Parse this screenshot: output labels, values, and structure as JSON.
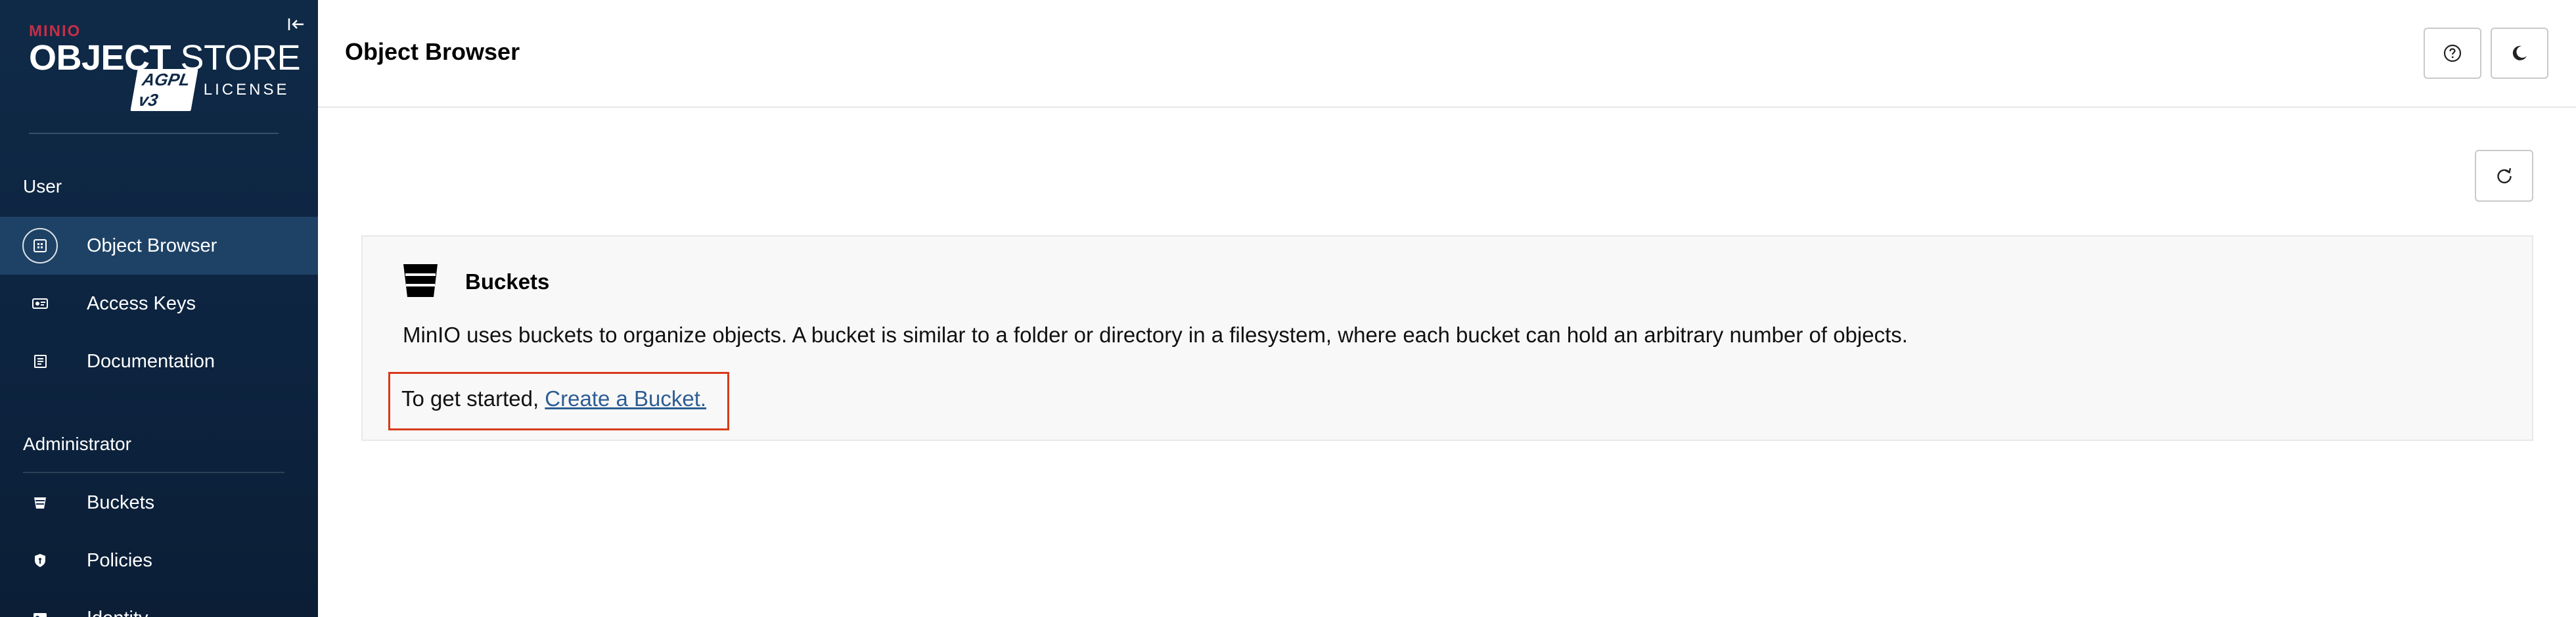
{
  "brand": {
    "minio": "MINIO",
    "product_bold": "OBJECT",
    "product_light": " STORE",
    "badge": "AGPL v3",
    "license": "LICENSE",
    "accent": "#c72e49",
    "sidebar_bg": "#0f2a47"
  },
  "sidebar": {
    "collapse_icon": "collapse-left-icon",
    "user_section": "User",
    "user_items": [
      {
        "label": "Object Browser",
        "icon": "object-browser-icon",
        "active": true
      },
      {
        "label": "Access Keys",
        "icon": "access-keys-icon",
        "active": false
      },
      {
        "label": "Documentation",
        "icon": "documentation-icon",
        "active": false
      }
    ],
    "admin_section": "Administrator",
    "admin_items": [
      {
        "label": "Buckets",
        "icon": "bucket-icon"
      },
      {
        "label": "Policies",
        "icon": "policies-icon"
      },
      {
        "label": "Identity",
        "icon": "identity-icon"
      }
    ]
  },
  "header": {
    "title": "Object Browser",
    "help_icon": "help-icon",
    "theme_icon": "dark-mode-icon"
  },
  "main": {
    "refresh_icon": "refresh-icon",
    "panel": {
      "title": "Buckets",
      "description": "MinIO uses buckets to organize objects. A bucket is similar to a folder or directory in a filesystem, where each bucket can hold an arbitrary number of objects.",
      "cta_prefix": "To get started, ",
      "cta_link": "Create a Bucket.",
      "highlight_color": "#d9391b"
    }
  }
}
